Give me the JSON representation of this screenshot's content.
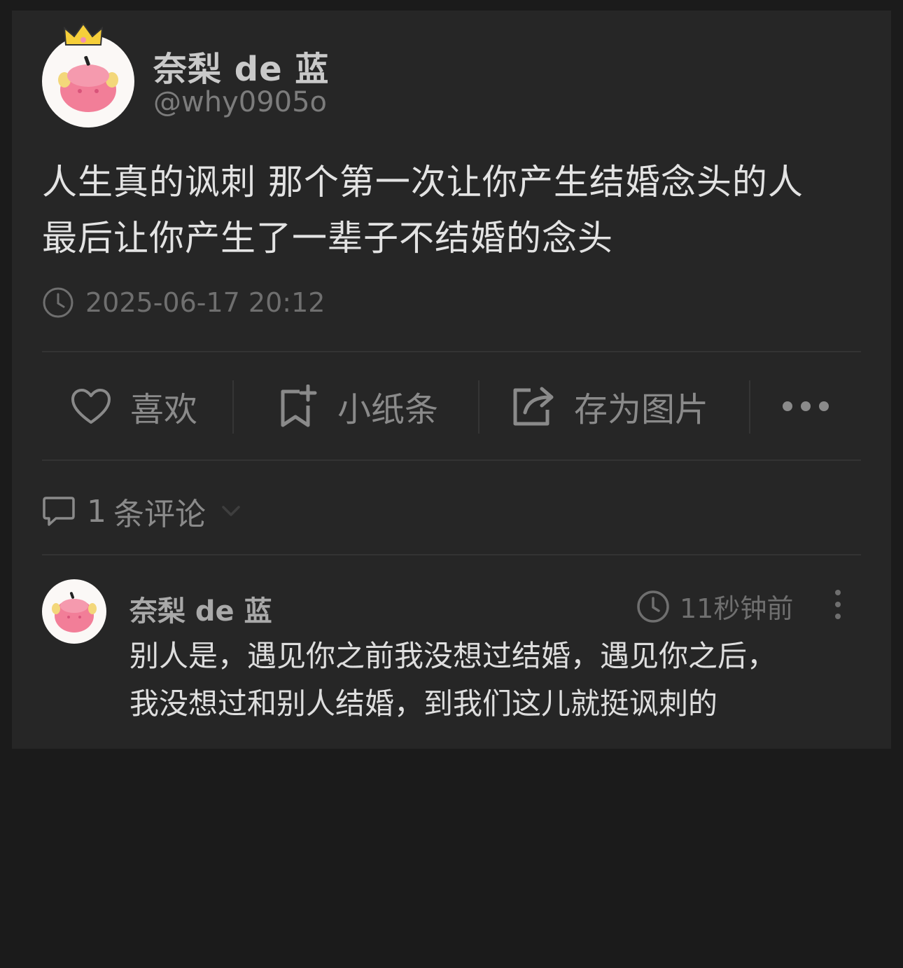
{
  "post": {
    "author_name": "奈梨 de 蓝",
    "author_handle": "@why0905o",
    "text_lines": [
      "人生真的讽刺 那个第一次让你产生结婚念头的人",
      "最后让你产生了一辈子不结婚的念头"
    ],
    "timestamp": "2025-06-17 20:12"
  },
  "actions": {
    "like_label": "喜欢",
    "note_label": "小纸条",
    "save_image_label": "存为图片"
  },
  "comments": {
    "count": "1",
    "label": "条评论",
    "items": [
      {
        "author": "奈梨 de 蓝",
        "time": "11秒钟前",
        "text_lines": [
          "别人是，遇见你之前我没想过结婚，遇见你之后，",
          "我没想过和别人结婚，到我们这儿就挺讽刺的"
        ]
      }
    ]
  },
  "icons": [
    "clock-icon",
    "heart-icon",
    "bookmark-add-icon",
    "share-icon",
    "more-horizontal-icon",
    "comment-icon",
    "chevron-down-icon",
    "more-vertical-icon"
  ],
  "colors": {
    "background": "#1b1b1b",
    "card": "#262626",
    "text": "#e3e3e3",
    "muted": "#8a8a8a"
  }
}
